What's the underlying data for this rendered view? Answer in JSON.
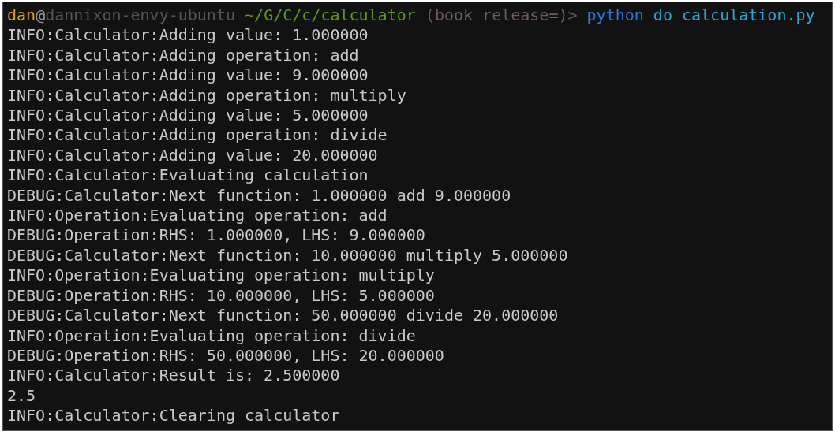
{
  "prompt": {
    "user": "dan",
    "at": "@",
    "host": "dannixon-envy-ubuntu",
    "path": "~/G/C/c/calculator",
    "branch": "(book_release=)>",
    "command": "python",
    "argument": "do_calculation.py"
  },
  "output_lines": [
    "INFO:Calculator:Adding value: 1.000000",
    "INFO:Calculator:Adding operation: add",
    "INFO:Calculator:Adding value: 9.000000",
    "INFO:Calculator:Adding operation: multiply",
    "INFO:Calculator:Adding value: 5.000000",
    "INFO:Calculator:Adding operation: divide",
    "INFO:Calculator:Adding value: 20.000000",
    "INFO:Calculator:Evaluating calculation",
    "DEBUG:Calculator:Next function: 1.000000 add 9.000000",
    "INFO:Operation:Evaluating operation: add",
    "DEBUG:Operation:RHS: 1.000000, LHS: 9.000000",
    "DEBUG:Calculator:Next function: 10.000000 multiply 5.000000",
    "INFO:Operation:Evaluating operation: multiply",
    "DEBUG:Operation:RHS: 10.000000, LHS: 5.000000",
    "DEBUG:Calculator:Next function: 50.000000 divide 20.000000",
    "INFO:Operation:Evaluating operation: divide",
    "DEBUG:Operation:RHS: 50.000000, LHS: 20.000000",
    "INFO:Calculator:Result is: 2.500000",
    "2.5",
    "INFO:Calculator:Clearing calculator"
  ]
}
